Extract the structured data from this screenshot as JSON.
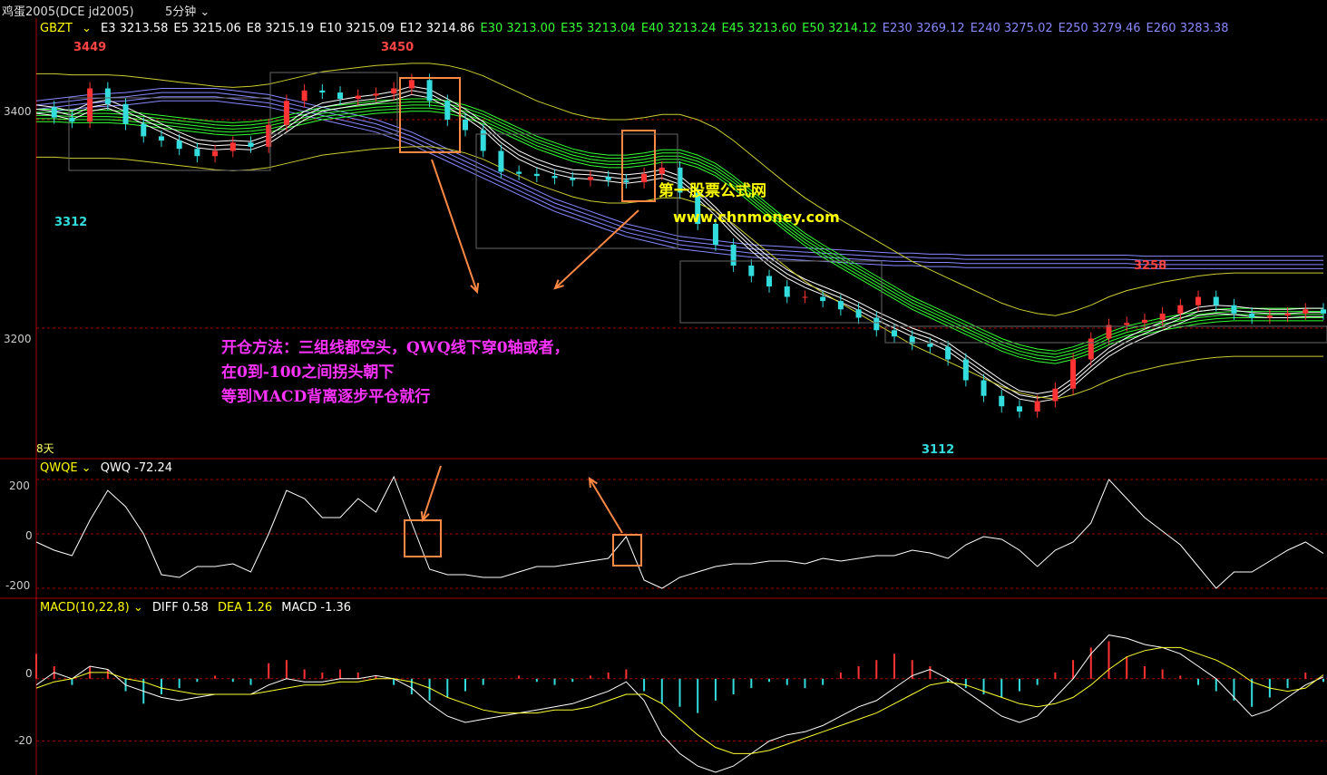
{
  "header": {
    "symbol": "鸡蛋2005(DCE jd2005)",
    "period": "5分钟",
    "period_icon": "chevron-down-icon"
  },
  "main_panel": {
    "indicator": "GBZT",
    "ma_values": [
      {
        "label": "E3 3213.58",
        "color": "#ffffff"
      },
      {
        "label": "E5 3215.06",
        "color": "#ffffff"
      },
      {
        "label": "E8 3215.19",
        "color": "#ffffff"
      },
      {
        "label": "E10 3215.09",
        "color": "#ffffff"
      },
      {
        "label": "E12 3214.86",
        "color": "#ffffff"
      },
      {
        "label": "E30 3213.00",
        "color": "#33ff33"
      },
      {
        "label": "E35 3213.04",
        "color": "#33ff33"
      },
      {
        "label": "E40 3213.24",
        "color": "#33ff33"
      },
      {
        "label": "E45 3213.60",
        "color": "#33ff33"
      },
      {
        "label": "E50 3214.12",
        "color": "#33ff33"
      },
      {
        "label": "E230 3269.12",
        "color": "#8888ff"
      },
      {
        "label": "E240 3275.02",
        "color": "#8888ff"
      },
      {
        "label": "E250 3279.46",
        "color": "#8888ff"
      },
      {
        "label": "E260 3283.38",
        "color": "#8888ff"
      }
    ],
    "price_marks": {
      "high1": "3449",
      "high2": "3450",
      "low1": "3312",
      "high3": "3258",
      "low2": "3112"
    },
    "axis_ticks": [
      "3400",
      "3200"
    ],
    "bottom_label": "8天",
    "annotation_lines": [
      "开仓方法：三组线都空头，QWQ线下穿0轴或者，",
      "在0到-100之间拐头朝下",
      "等到MACD背离逐步平仓就行"
    ],
    "watermark_name": "第一股票公式网",
    "watermark_url": "www.chnmoney.com"
  },
  "qwq_panel": {
    "indicator": "QWQE",
    "value_label": "QWQ -72.24",
    "axis_ticks": [
      "200",
      "0",
      "-200"
    ]
  },
  "macd_panel": {
    "indicator": "MACD(10,22,8)",
    "diff_label": "DIFF 0.58",
    "dea_label": "DEA 1.26",
    "macd_label": "MACD -1.36",
    "axis_ticks": [
      "0",
      "-20"
    ]
  },
  "colors": {
    "up": "#ff3333",
    "down": "#33dddd",
    "grid_red": "#aa0000",
    "short_ma": "#ffffff",
    "mid_ma": "#33ff33",
    "long_ma": "#8888ff",
    "box": "#ff8844",
    "note": "#ff33ff"
  },
  "chart_data": [
    {
      "type": "line",
      "name": "price",
      "ylim": [
        3080,
        3480
      ],
      "x": [
        0,
        10,
        20,
        30,
        40,
        50,
        60,
        70,
        80,
        90,
        100,
        110,
        120,
        130,
        140,
        150,
        160,
        170,
        180,
        190,
        200,
        210,
        220,
        230,
        240,
        250,
        260,
        270,
        280,
        290,
        300,
        310,
        320,
        330,
        340,
        350,
        360,
        370,
        380,
        390,
        400,
        410,
        420,
        430,
        440,
        450,
        460,
        470,
        480,
        490,
        500,
        510,
        520,
        530,
        540,
        550,
        560,
        570,
        580,
        590,
        600,
        610,
        620,
        630,
        640,
        650,
        660,
        670,
        680,
        690,
        700,
        710,
        720
      ],
      "close": [
        3412,
        3402,
        3398,
        3430,
        3415,
        3396,
        3384,
        3380,
        3372,
        3365,
        3370,
        3378,
        3374,
        3395,
        3418,
        3428,
        3426,
        3420,
        3423,
        3425,
        3430,
        3438,
        3418,
        3400,
        3390,
        3370,
        3350,
        3348,
        3346,
        3344,
        3342,
        3345,
        3342,
        3340,
        3348,
        3354,
        3330,
        3300,
        3280,
        3260,
        3250,
        3240,
        3230,
        3230,
        3226,
        3218,
        3210,
        3198,
        3192,
        3185,
        3182,
        3170,
        3150,
        3135,
        3125,
        3120,
        3130,
        3142,
        3170,
        3190,
        3203,
        3205,
        3208,
        3214,
        3222,
        3230,
        3222,
        3214,
        3210,
        3212,
        3214,
        3218,
        3214
      ],
      "ema_short": [
        3410,
        3408,
        3404,
        3412,
        3415,
        3408,
        3400,
        3392,
        3384,
        3377,
        3375,
        3376,
        3375,
        3381,
        3392,
        3404,
        3412,
        3415,
        3418,
        3420,
        3423,
        3428,
        3425,
        3416,
        3406,
        3394,
        3378,
        3366,
        3358,
        3352,
        3348,
        3347,
        3345,
        3343,
        3345,
        3348,
        3342,
        3328,
        3312,
        3294,
        3278,
        3264,
        3252,
        3243,
        3236,
        3229,
        3221,
        3212,
        3204,
        3196,
        3190,
        3182,
        3170,
        3158,
        3146,
        3136,
        3133,
        3136,
        3148,
        3163,
        3177,
        3187,
        3195,
        3202,
        3209,
        3216,
        3218,
        3217,
        3215,
        3214,
        3214,
        3215,
        3215
      ],
      "ema_mid": [
        3404,
        3404,
        3403,
        3403,
        3403,
        3402,
        3400,
        3398,
        3396,
        3394,
        3392,
        3391,
        3392,
        3394,
        3398,
        3402,
        3406,
        3408,
        3410,
        3412,
        3413,
        3414,
        3414,
        3412,
        3408,
        3402,
        3394,
        3386,
        3378,
        3372,
        3366,
        3362,
        3360,
        3360,
        3362,
        3365,
        3365,
        3360,
        3352,
        3340,
        3326,
        3312,
        3298,
        3285,
        3274,
        3264,
        3254,
        3244,
        3234,
        3224,
        3216,
        3208,
        3200,
        3192,
        3184,
        3178,
        3174,
        3172,
        3176,
        3182,
        3190,
        3196,
        3200,
        3204,
        3207,
        3210,
        3212,
        3213,
        3213,
        3213,
        3213,
        3213,
        3213
      ],
      "ema_long": [
        3418,
        3420,
        3422,
        3424,
        3425,
        3426,
        3428,
        3430,
        3430,
        3430,
        3430,
        3428,
        3426,
        3424,
        3420,
        3416,
        3412,
        3408,
        3404,
        3400,
        3394,
        3388,
        3380,
        3372,
        3364,
        3356,
        3348,
        3340,
        3332,
        3324,
        3318,
        3312,
        3306,
        3300,
        3296,
        3292,
        3288,
        3286,
        3284,
        3282,
        3280,
        3279,
        3278,
        3277,
        3276,
        3275,
        3274,
        3273,
        3272,
        3272,
        3271,
        3271,
        3270,
        3270,
        3270,
        3270,
        3270,
        3270,
        3270,
        3270,
        3270,
        3270,
        3269,
        3269,
        3269,
        3269,
        3269,
        3269,
        3269,
        3269,
        3269,
        3269,
        3269
      ]
    },
    {
      "type": "line",
      "name": "QWQ",
      "ylim": [
        -220,
        230
      ],
      "x": [
        0,
        10,
        20,
        30,
        40,
        50,
        60,
        70,
        80,
        90,
        100,
        110,
        120,
        130,
        140,
        150,
        160,
        170,
        180,
        190,
        200,
        210,
        220,
        230,
        240,
        250,
        260,
        270,
        280,
        290,
        300,
        310,
        320,
        330,
        340,
        350,
        360,
        370,
        380,
        390,
        400,
        410,
        420,
        430,
        440,
        450,
        460,
        470,
        480,
        490,
        500,
        510,
        520,
        530,
        540,
        550,
        560,
        570,
        580,
        590,
        600,
        610,
        620,
        630,
        640,
        650,
        660,
        670,
        680,
        690,
        700,
        710,
        720
      ],
      "values": [
        -30,
        -60,
        -80,
        50,
        160,
        100,
        0,
        -150,
        -160,
        -120,
        -120,
        -110,
        -140,
        0,
        160,
        130,
        60,
        60,
        130,
        80,
        210,
        40,
        -130,
        -150,
        -150,
        -160,
        -160,
        -140,
        -120,
        -120,
        -110,
        -100,
        -90,
        -10,
        -170,
        -200,
        -160,
        -140,
        -120,
        -110,
        -110,
        -100,
        -100,
        -110,
        -90,
        -100,
        -90,
        -80,
        -80,
        -60,
        -70,
        -90,
        -40,
        -10,
        -20,
        -60,
        -120,
        -60,
        -30,
        40,
        200,
        130,
        60,
        10,
        -40,
        -120,
        -200,
        -140,
        -140,
        -100,
        -60,
        -30,
        -72
      ]
    },
    {
      "type": "bar",
      "name": "MACD",
      "ylim": [
        -30,
        20
      ],
      "x": [
        0,
        10,
        20,
        30,
        40,
        50,
        60,
        70,
        80,
        90,
        100,
        110,
        120,
        130,
        140,
        150,
        160,
        170,
        180,
        190,
        200,
        210,
        220,
        230,
        240,
        250,
        260,
        270,
        280,
        290,
        300,
        310,
        320,
        330,
        340,
        350,
        360,
        370,
        380,
        390,
        400,
        410,
        420,
        430,
        440,
        450,
        460,
        470,
        480,
        490,
        500,
        510,
        520,
        530,
        540,
        550,
        560,
        570,
        580,
        590,
        600,
        610,
        620,
        630,
        640,
        650,
        660,
        670,
        680,
        690,
        700,
        710,
        720
      ],
      "hist": [
        8,
        4,
        -2,
        4,
        3,
        -4,
        -8,
        -5,
        -3,
        -1,
        1,
        -1,
        -2,
        5,
        6,
        3,
        2,
        3,
        2,
        1,
        -2,
        -5,
        -7,
        -6,
        -4,
        -2,
        0,
        1,
        -1,
        -2,
        -1,
        1,
        2,
        3,
        -4,
        -8,
        -9,
        -11,
        -7,
        -5,
        -3,
        -1,
        -2,
        -3,
        -2,
        2,
        4,
        6,
        8,
        6,
        4,
        -1,
        -3,
        -5,
        -6,
        -4,
        -2,
        2,
        6,
        10,
        12,
        7,
        4,
        3,
        1,
        -2,
        -4,
        -7,
        -9,
        -6,
        -3,
        2,
        -1
      ],
      "diff": [
        -2,
        2,
        0,
        4,
        3,
        -2,
        -4,
        -6,
        -7,
        -6,
        -5,
        -5,
        -5,
        -2,
        0,
        -1,
        -1,
        0,
        0,
        1,
        0,
        -3,
        -8,
        -12,
        -14,
        -13,
        -12,
        -11,
        -10,
        -9,
        -8,
        -6,
        -4,
        -1,
        -7,
        -18,
        -24,
        -28,
        -30,
        -28,
        -24,
        -20,
        -18,
        -17,
        -15,
        -12,
        -9,
        -7,
        -3,
        1,
        3,
        0,
        -4,
        -8,
        -12,
        -14,
        -12,
        -6,
        0,
        8,
        14,
        13,
        11,
        10,
        8,
        4,
        0,
        -6,
        -12,
        -10,
        -6,
        -2,
        0.58
      ],
      "dea": [
        -3,
        -1,
        0,
        2,
        2,
        0,
        -1,
        -3,
        -4,
        -5,
        -5,
        -5,
        -5,
        -4,
        -3,
        -2,
        -2,
        -1,
        -1,
        0,
        0,
        -1,
        -3,
        -6,
        -8,
        -10,
        -11,
        -11,
        -11,
        -10,
        -10,
        -9,
        -7,
        -5,
        -5,
        -8,
        -13,
        -18,
        -22,
        -24,
        -24,
        -23,
        -21,
        -19,
        -17,
        -15,
        -13,
        -11,
        -8,
        -5,
        -2,
        -1,
        -2,
        -4,
        -6,
        -8,
        -9,
        -8,
        -6,
        -2,
        3,
        7,
        9,
        10,
        10,
        8,
        6,
        3,
        -1,
        -3,
        -4,
        -3,
        1.26
      ]
    }
  ]
}
